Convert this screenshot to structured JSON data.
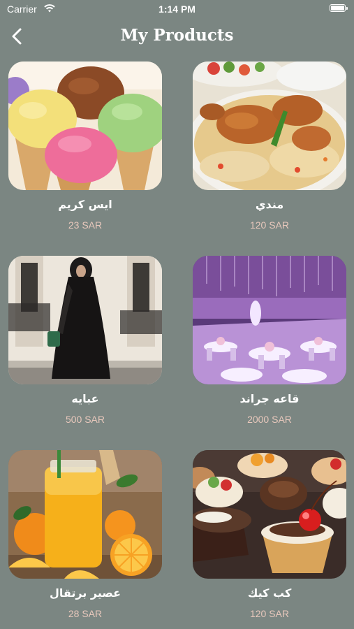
{
  "status_bar": {
    "carrier": "Carrier",
    "time": "1:14 PM"
  },
  "nav": {
    "title": "My Products"
  },
  "products": [
    {
      "name": "ايس كريم",
      "price": "23 SAR",
      "image": "ice-cream"
    },
    {
      "name": "مندي",
      "price": "120 SAR",
      "image": "mandi"
    },
    {
      "name": "عبايه",
      "price": "500 SAR",
      "image": "abaya"
    },
    {
      "name": "قاعه جراند",
      "price": "2000 SAR",
      "image": "grand-hall"
    },
    {
      "name": "عصير برتقال",
      "price": "28 SAR",
      "image": "orange-juice"
    },
    {
      "name": "كب كيك",
      "price": "120 SAR",
      "image": "cupcake"
    }
  ],
  "colors": {
    "background": "#7b8682",
    "price_text": "#e8c8bc",
    "title_text": "#ffffff"
  }
}
